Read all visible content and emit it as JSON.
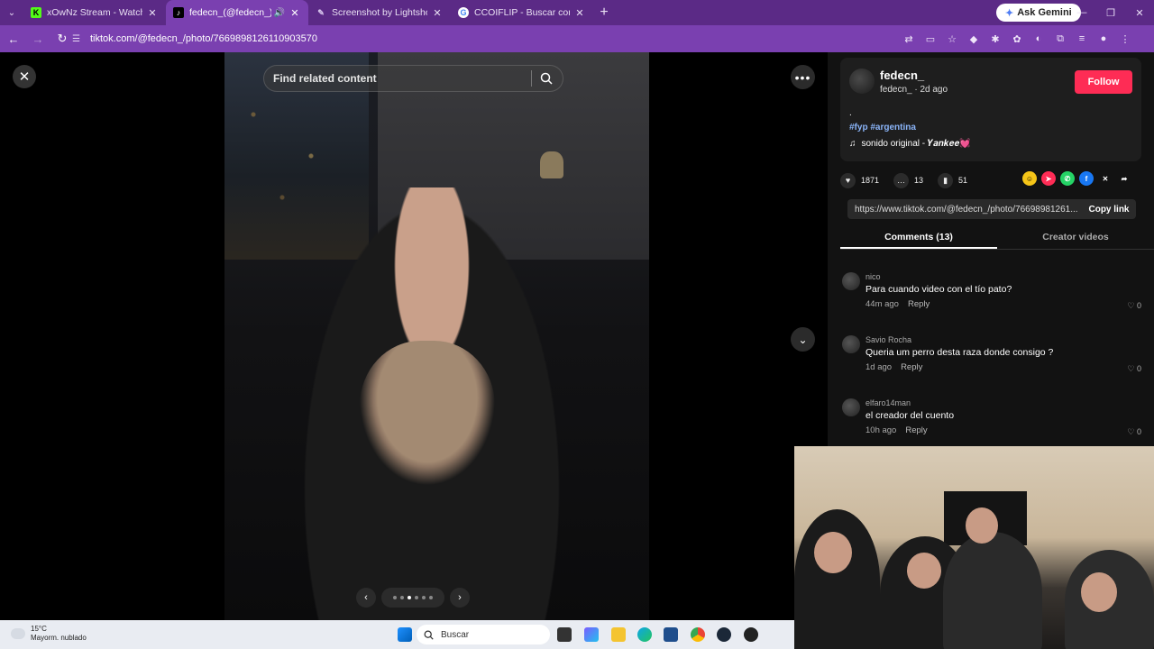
{
  "browser": {
    "tabs": [
      {
        "title": "xOwNz Stream - Watch Live on",
        "favicon": "K",
        "color": "#53fc18"
      },
      {
        "title": "fedecn_(@fedecn_) | TikTok",
        "favicon": "♪",
        "color": "#000000"
      },
      {
        "title": "Screenshot by Lightshot",
        "favicon": "✎",
        "color": "#7a40b0"
      },
      {
        "title": "CCOIFLIP - Buscar con Google",
        "favicon": "G",
        "color": "#ffffff"
      }
    ],
    "ask_gemini": "Ask Gemini",
    "url": "tiktok.com/@fedecn_/photo/7669898126110903570"
  },
  "viewer": {
    "search_placeholder": "Find related content"
  },
  "post": {
    "username": "fedecn_",
    "handle_time": "fedecn_ · 2d ago",
    "follow_label": "Follow",
    "caption": ".",
    "hashtags": "#fyp #argentina",
    "music": "sonido original - 𝒀𝒂𝒏𝒌𝒆𝒆💓",
    "likes": "1871",
    "comments": "13",
    "saves": "51",
    "link": "https://www.tiktok.com/@fedecn_/photo/76698981261...",
    "copy_link": "Copy link",
    "tab_comments": "Comments (13)",
    "tab_creator": "Creator videos"
  },
  "comments": [
    {
      "name": "nico",
      "text": "Para cuando video con el tío pato?",
      "time": "44m ago",
      "reply": "Reply",
      "likes": "0"
    },
    {
      "name": "Savio Rocha",
      "text": "Queria um perro desta raza donde consigo ?",
      "time": "1d ago",
      "reply": "Reply",
      "likes": "0"
    },
    {
      "name": "elfaro14man",
      "text": "el creador del cuento",
      "time": "10h ago",
      "reply": "Reply",
      "likes": "0"
    }
  ],
  "taskbar": {
    "temp": "15°C",
    "weather": "Mayorm. nublado",
    "search": "Buscar"
  },
  "colors": {
    "tabbar": "#5b2a86",
    "toolbar": "#7a40b0",
    "follow": "#fe2c55"
  }
}
